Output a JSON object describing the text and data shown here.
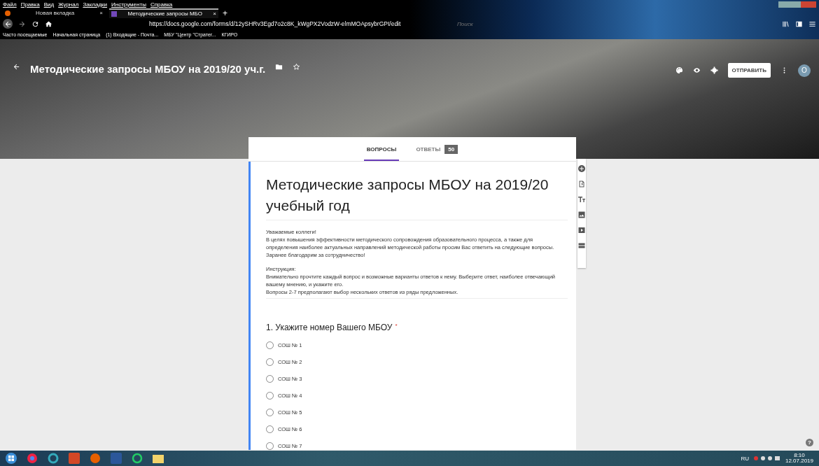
{
  "menu_bar": [
    "Файл",
    "Правка",
    "Вид",
    "Журнал",
    "Закладки",
    "Инструменты",
    "Справка"
  ],
  "tabs": [
    {
      "label": "Новая вкладка",
      "close": "×",
      "selected": false
    },
    {
      "label": "Методические запросы МБО",
      "close": "×",
      "selected": true
    }
  ],
  "new_tab": "+",
  "address": "https://docs.google.com/forms/d/12ySHRv3Egd7o2c8K_kWgPX2VodzW-elmMOApsybrGPI/edit",
  "search_placeholder": "Поиск",
  "bookmarks": [
    "Часто посещаемые",
    "Начальная страница",
    "(1) Входящие - Почта...",
    "МБУ \"Центр \"Стратег...",
    "КГИРО"
  ],
  "form_header": {
    "title": "Методические запросы МБОУ на 2019/20 уч.г.",
    "send": "ОТПРАВИТЬ",
    "avatar": "О"
  },
  "form_tabs": [
    {
      "label": "ВОПРОСЫ",
      "selected": true
    },
    {
      "label": "ОТВЕТЫ",
      "selected": false,
      "badge": "50"
    }
  ],
  "form": {
    "title": "Методические запросы МБОУ на 2019/20 учебный год",
    "description": [
      [
        "Уважаемые коллеги!",
        "В целях повышения эффективности методического сопровождения образовательного процесса, а также для определения наиболее актуальных направлений методической работы просим Вас ответить на следующие вопросы.",
        "Заранее благодарим за сотрудничество!"
      ],
      [
        "Инструкция:",
        "Внимательно прочтите каждый вопрос и возможные варианты ответов к нему. Выберите ответ, наиболее отвечающий вашему мнению, и укажите его.",
        "Вопросы 2-7 предполагают выбор нескольких ответов из ряды предложенных."
      ]
    ]
  },
  "question": {
    "title": "1. Укажите номер Вашего МБОУ",
    "required": "*",
    "options": [
      {
        "label": "СОШ № 1",
        "selected": false
      },
      {
        "label": "СОШ № 2",
        "selected": false
      },
      {
        "label": "СОШ № 3",
        "selected": false
      },
      {
        "label": "СОШ № 4",
        "selected": false
      },
      {
        "label": "СОШ № 5",
        "selected": false
      },
      {
        "label": "СОШ № 6",
        "selected": false
      },
      {
        "label": "СОШ № 7",
        "selected": false
      }
    ]
  },
  "help": "?",
  "tray": {
    "lang": "RU",
    "time": "8:10",
    "date": "12.07.2019"
  }
}
